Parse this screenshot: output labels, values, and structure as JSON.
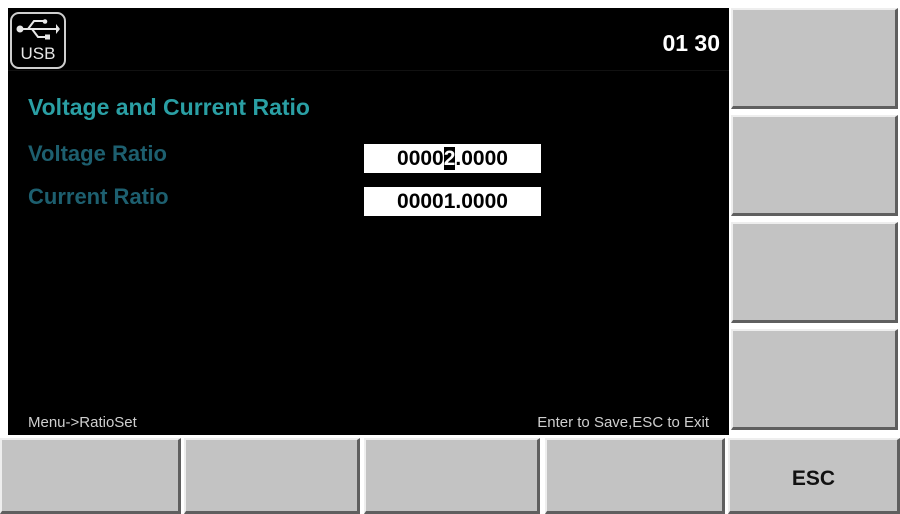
{
  "status_bar": {
    "usb_label": "USB",
    "usb_icon": "usb-icon",
    "clock": "01 30"
  },
  "page": {
    "title": "Voltage and Current Ratio",
    "fields": [
      {
        "label": "Voltage Ratio",
        "value_before_cursor": "0000",
        "value_cursor": "2",
        "value_after_cursor": ".0000"
      },
      {
        "label": "Current Ratio",
        "value": "00001.0000"
      }
    ]
  },
  "footer": {
    "path": "Menu->RatioSet",
    "hint": "Enter to Save,ESC to Exit"
  },
  "softkeys": {
    "right": [
      "",
      "",
      "",
      ""
    ],
    "bottom": [
      "",
      "",
      "",
      "",
      "ESC"
    ]
  },
  "colors": {
    "title": "#2a9fa4",
    "field_label": "#1d5f6f",
    "key_face": "#c3c3c3"
  }
}
